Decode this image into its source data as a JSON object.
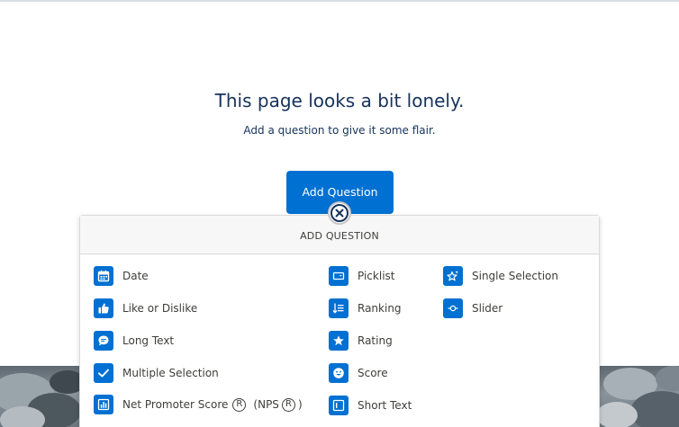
{
  "empty_state": {
    "title": "This page looks a bit lonely.",
    "subtitle": "Add a question to give it some flair."
  },
  "add_button": {
    "label": "Add Question"
  },
  "panel": {
    "header": "ADD QUESTION",
    "items": [
      {
        "label": "Date",
        "icon": "calendar-icon"
      },
      {
        "label": "Like or Dislike",
        "icon": "thumbs-up-icon"
      },
      {
        "label": "Long Text",
        "icon": "chat-bubble-icon"
      },
      {
        "label": "Multiple Selection",
        "icon": "checkmark-icon"
      },
      {
        "label": "Net Promoter Score",
        "reg_mark": "R",
        "open_paren": "(",
        "nps_label": "NPS",
        "close_paren": ")",
        "icon": "bar-chart-icon"
      },
      {
        "label": "Picklist",
        "icon": "dropdown-box-icon"
      },
      {
        "label": "Ranking",
        "icon": "ranking-list-icon"
      },
      {
        "label": "Rating",
        "icon": "star-icon"
      },
      {
        "label": "Score",
        "icon": "smiley-icon"
      },
      {
        "label": "Short Text",
        "icon": "text-box-icon"
      },
      {
        "label": "Single Selection",
        "icon": "star-sparkle-icon"
      },
      {
        "label": "Slider",
        "icon": "slider-icon"
      }
    ]
  },
  "colors": {
    "accent": "#0070d2",
    "text": "#16325c",
    "label": "#3e3e3c",
    "header_bg": "#f7f7f7"
  }
}
